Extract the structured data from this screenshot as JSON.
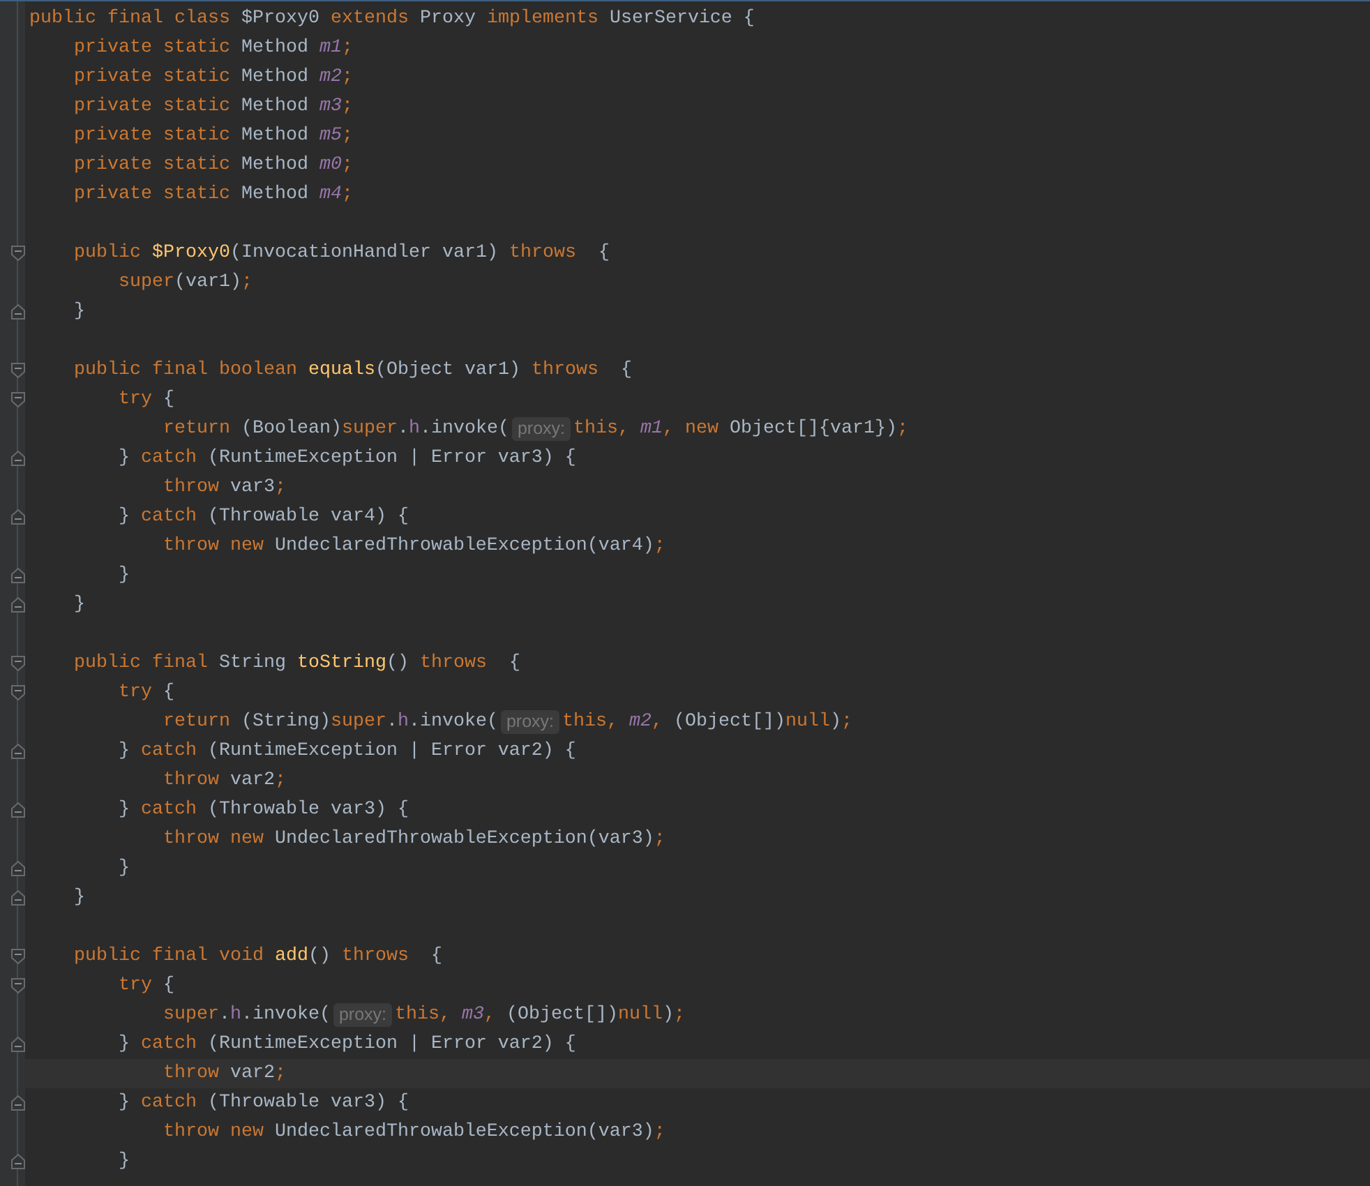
{
  "lines": [
    {
      "fold_start": false,
      "fold_end": false,
      "current": false,
      "tokens": [
        {
          "kind": "kw",
          "text": "public final class "
        },
        {
          "kind": "p",
          "text": "$Proxy0 "
        },
        {
          "kind": "kw",
          "text": "extends "
        },
        {
          "kind": "p",
          "text": "Proxy "
        },
        {
          "kind": "kw",
          "text": "implements "
        },
        {
          "kind": "p",
          "text": "UserService {"
        }
      ]
    },
    {
      "fold_start": false,
      "fold_end": false,
      "current": false,
      "tokens": [
        {
          "kind": "kw",
          "text": "    private static "
        },
        {
          "kind": "p",
          "text": "Method "
        },
        {
          "kind": "s",
          "text": "m1"
        },
        {
          "kind": "kw",
          "text": ";"
        }
      ]
    },
    {
      "fold_start": false,
      "fold_end": false,
      "current": false,
      "tokens": [
        {
          "kind": "kw",
          "text": "    private static "
        },
        {
          "kind": "p",
          "text": "Method "
        },
        {
          "kind": "s",
          "text": "m2"
        },
        {
          "kind": "kw",
          "text": ";"
        }
      ]
    },
    {
      "fold_start": false,
      "fold_end": false,
      "current": false,
      "tokens": [
        {
          "kind": "kw",
          "text": "    private static "
        },
        {
          "kind": "p",
          "text": "Method "
        },
        {
          "kind": "s",
          "text": "m3"
        },
        {
          "kind": "kw",
          "text": ";"
        }
      ]
    },
    {
      "fold_start": false,
      "fold_end": false,
      "current": false,
      "tokens": [
        {
          "kind": "kw",
          "text": "    private static "
        },
        {
          "kind": "p",
          "text": "Method "
        },
        {
          "kind": "s",
          "text": "m5"
        },
        {
          "kind": "kw",
          "text": ";"
        }
      ]
    },
    {
      "fold_start": false,
      "fold_end": false,
      "current": false,
      "tokens": [
        {
          "kind": "kw",
          "text": "    private static "
        },
        {
          "kind": "p",
          "text": "Method "
        },
        {
          "kind": "s",
          "text": "m0"
        },
        {
          "kind": "kw",
          "text": ";"
        }
      ]
    },
    {
      "fold_start": false,
      "fold_end": false,
      "current": false,
      "tokens": [
        {
          "kind": "kw",
          "text": "    private static "
        },
        {
          "kind": "p",
          "text": "Method "
        },
        {
          "kind": "s",
          "text": "m4"
        },
        {
          "kind": "kw",
          "text": ";"
        }
      ]
    },
    {
      "fold_start": false,
      "fold_end": false,
      "current": false
    },
    {
      "fold_start": true,
      "fold_end": false,
      "current": false,
      "tokens": [
        {
          "kind": "kw",
          "text": "    public "
        },
        {
          "kind": "f",
          "text": "$Proxy0"
        },
        {
          "kind": "p",
          "text": "(InvocationHandler var1) "
        },
        {
          "kind": "kw",
          "text": "throws"
        },
        {
          "kind": "p",
          "text": "  {"
        }
      ]
    },
    {
      "fold_start": false,
      "fold_end": false,
      "current": false,
      "tokens": [
        {
          "kind": "kw",
          "text": "        super"
        },
        {
          "kind": "p",
          "text": "(var1)"
        },
        {
          "kind": "kw",
          "text": ";"
        }
      ]
    },
    {
      "fold_start": false,
      "fold_end": true,
      "current": false,
      "tokens": [
        {
          "kind": "p",
          "text": "    }"
        }
      ]
    },
    {
      "fold_start": false,
      "fold_end": false,
      "current": false
    },
    {
      "fold_start": true,
      "fold_end": false,
      "current": false,
      "tokens": [
        {
          "kind": "kw",
          "text": "    public final boolean "
        },
        {
          "kind": "f",
          "text": "equals"
        },
        {
          "kind": "p",
          "text": "(Object var1) "
        },
        {
          "kind": "kw",
          "text": "throws"
        },
        {
          "kind": "p",
          "text": "  {"
        }
      ]
    },
    {
      "fold_start": true,
      "fold_end": false,
      "current": false,
      "tokens": [
        {
          "kind": "kw",
          "text": "        try "
        },
        {
          "kind": "p",
          "text": "{"
        }
      ]
    },
    {
      "fold_start": false,
      "fold_end": false,
      "current": false,
      "tokens": [
        {
          "kind": "kw",
          "text": "            return "
        },
        {
          "kind": "p",
          "text": "(Boolean)"
        },
        {
          "kind": "kw",
          "text": "super"
        },
        {
          "kind": "p",
          "text": "."
        },
        {
          "kind": "m",
          "text": "h"
        },
        {
          "kind": "p",
          "text": ".invoke("
        },
        {
          "kind": "h",
          "text": "proxy:"
        },
        {
          "kind": "kw",
          "text": "this, "
        },
        {
          "kind": "s",
          "text": "m1"
        },
        {
          "kind": "kw",
          "text": ", new "
        },
        {
          "kind": "p",
          "text": "Object[]{var1})"
        },
        {
          "kind": "kw",
          "text": ";"
        }
      ]
    },
    {
      "fold_start": false,
      "fold_end": true,
      "current": false,
      "tokens": [
        {
          "kind": "p",
          "text": "        } "
        },
        {
          "kind": "kw",
          "text": "catch "
        },
        {
          "kind": "p",
          "text": "(RuntimeException | Error var3) {"
        }
      ]
    },
    {
      "fold_start": false,
      "fold_end": false,
      "current": false,
      "tokens": [
        {
          "kind": "kw",
          "text": "            throw "
        },
        {
          "kind": "p",
          "text": "var3"
        },
        {
          "kind": "kw",
          "text": ";"
        }
      ]
    },
    {
      "fold_start": false,
      "fold_end": true,
      "current": false,
      "tokens": [
        {
          "kind": "p",
          "text": "        } "
        },
        {
          "kind": "kw",
          "text": "catch "
        },
        {
          "kind": "p",
          "text": "(Throwable var4) {"
        }
      ]
    },
    {
      "fold_start": false,
      "fold_end": false,
      "current": false,
      "tokens": [
        {
          "kind": "kw",
          "text": "            throw new "
        },
        {
          "kind": "p",
          "text": "UndeclaredThrowableException(var4)"
        },
        {
          "kind": "kw",
          "text": ";"
        }
      ]
    },
    {
      "fold_start": false,
      "fold_end": true,
      "current": false,
      "tokens": [
        {
          "kind": "p",
          "text": "        }"
        }
      ]
    },
    {
      "fold_start": false,
      "fold_end": true,
      "current": false,
      "tokens": [
        {
          "kind": "p",
          "text": "    }"
        }
      ]
    },
    {
      "fold_start": false,
      "fold_end": false,
      "current": false
    },
    {
      "fold_start": true,
      "fold_end": false,
      "current": false,
      "tokens": [
        {
          "kind": "kw",
          "text": "    public final "
        },
        {
          "kind": "p",
          "text": "String "
        },
        {
          "kind": "f",
          "text": "toString"
        },
        {
          "kind": "p",
          "text": "() "
        },
        {
          "kind": "kw",
          "text": "throws"
        },
        {
          "kind": "p",
          "text": "  {"
        }
      ]
    },
    {
      "fold_start": true,
      "fold_end": false,
      "current": false,
      "tokens": [
        {
          "kind": "kw",
          "text": "        try "
        },
        {
          "kind": "p",
          "text": "{"
        }
      ]
    },
    {
      "fold_start": false,
      "fold_end": false,
      "current": false,
      "tokens": [
        {
          "kind": "kw",
          "text": "            return "
        },
        {
          "kind": "p",
          "text": "(String)"
        },
        {
          "kind": "kw",
          "text": "super"
        },
        {
          "kind": "p",
          "text": "."
        },
        {
          "kind": "m",
          "text": "h"
        },
        {
          "kind": "p",
          "text": ".invoke("
        },
        {
          "kind": "h",
          "text": "proxy:"
        },
        {
          "kind": "kw",
          "text": "this, "
        },
        {
          "kind": "s",
          "text": "m2"
        },
        {
          "kind": "kw",
          "text": ", "
        },
        {
          "kind": "p",
          "text": "(Object[])"
        },
        {
          "kind": "kw",
          "text": "null"
        },
        {
          "kind": "p",
          "text": ")"
        },
        {
          "kind": "kw",
          "text": ";"
        }
      ]
    },
    {
      "fold_start": false,
      "fold_end": true,
      "current": false,
      "tokens": [
        {
          "kind": "p",
          "text": "        } "
        },
        {
          "kind": "kw",
          "text": "catch "
        },
        {
          "kind": "p",
          "text": "(RuntimeException | Error var2) {"
        }
      ]
    },
    {
      "fold_start": false,
      "fold_end": false,
      "current": false,
      "tokens": [
        {
          "kind": "kw",
          "text": "            throw "
        },
        {
          "kind": "p",
          "text": "var2"
        },
        {
          "kind": "kw",
          "text": ";"
        }
      ]
    },
    {
      "fold_start": false,
      "fold_end": true,
      "current": false,
      "tokens": [
        {
          "kind": "p",
          "text": "        } "
        },
        {
          "kind": "kw",
          "text": "catch "
        },
        {
          "kind": "p",
          "text": "(Throwable var3) {"
        }
      ]
    },
    {
      "fold_start": false,
      "fold_end": false,
      "current": false,
      "tokens": [
        {
          "kind": "kw",
          "text": "            throw new "
        },
        {
          "kind": "p",
          "text": "UndeclaredThrowableException(var3)"
        },
        {
          "kind": "kw",
          "text": ";"
        }
      ]
    },
    {
      "fold_start": false,
      "fold_end": true,
      "current": false,
      "tokens": [
        {
          "kind": "p",
          "text": "        }"
        }
      ]
    },
    {
      "fold_start": false,
      "fold_end": true,
      "current": false,
      "tokens": [
        {
          "kind": "p",
          "text": "    }"
        }
      ]
    },
    {
      "fold_start": false,
      "fold_end": false,
      "current": false
    },
    {
      "fold_start": true,
      "fold_end": false,
      "current": false,
      "tokens": [
        {
          "kind": "kw",
          "text": "    public final void "
        },
        {
          "kind": "f",
          "text": "add"
        },
        {
          "kind": "p",
          "text": "() "
        },
        {
          "kind": "kw",
          "text": "throws"
        },
        {
          "kind": "p",
          "text": "  {"
        }
      ]
    },
    {
      "fold_start": true,
      "fold_end": false,
      "current": false,
      "tokens": [
        {
          "kind": "kw",
          "text": "        try "
        },
        {
          "kind": "p",
          "text": "{"
        }
      ]
    },
    {
      "fold_start": false,
      "fold_end": false,
      "current": false,
      "tokens": [
        {
          "kind": "kw",
          "text": "            super"
        },
        {
          "kind": "p",
          "text": "."
        },
        {
          "kind": "m",
          "text": "h"
        },
        {
          "kind": "p",
          "text": ".invoke("
        },
        {
          "kind": "h",
          "text": "proxy:"
        },
        {
          "kind": "kw",
          "text": "this, "
        },
        {
          "kind": "s",
          "text": "m3"
        },
        {
          "kind": "kw",
          "text": ", "
        },
        {
          "kind": "p",
          "text": "(Object[])"
        },
        {
          "kind": "kw",
          "text": "null"
        },
        {
          "kind": "p",
          "text": ")"
        },
        {
          "kind": "kw",
          "text": ";"
        }
      ]
    },
    {
      "fold_start": false,
      "fold_end": true,
      "current": false,
      "tokens": [
        {
          "kind": "p",
          "text": "        } "
        },
        {
          "kind": "kw",
          "text": "catch "
        },
        {
          "kind": "p",
          "text": "(RuntimeException | Error var2) {"
        }
      ]
    },
    {
      "fold_start": false,
      "fold_end": false,
      "current": true,
      "tokens": [
        {
          "kind": "kw",
          "text": "            throw "
        },
        {
          "kind": "p",
          "text": "var2"
        },
        {
          "kind": "kw",
          "text": ";"
        }
      ]
    },
    {
      "fold_start": false,
      "fold_end": true,
      "current": false,
      "tokens": [
        {
          "kind": "p",
          "text": "        } "
        },
        {
          "kind": "kw",
          "text": "catch "
        },
        {
          "kind": "p",
          "text": "(Throwable var3) {"
        }
      ]
    },
    {
      "fold_start": false,
      "fold_end": false,
      "current": false,
      "tokens": [
        {
          "kind": "kw",
          "text": "            throw new "
        },
        {
          "kind": "p",
          "text": "UndeclaredThrowableException(var3)"
        },
        {
          "kind": "kw",
          "text": ";"
        }
      ]
    },
    {
      "fold_start": false,
      "fold_end": true,
      "current": false,
      "tokens": [
        {
          "kind": "p",
          "text": "        }"
        }
      ]
    }
  ]
}
